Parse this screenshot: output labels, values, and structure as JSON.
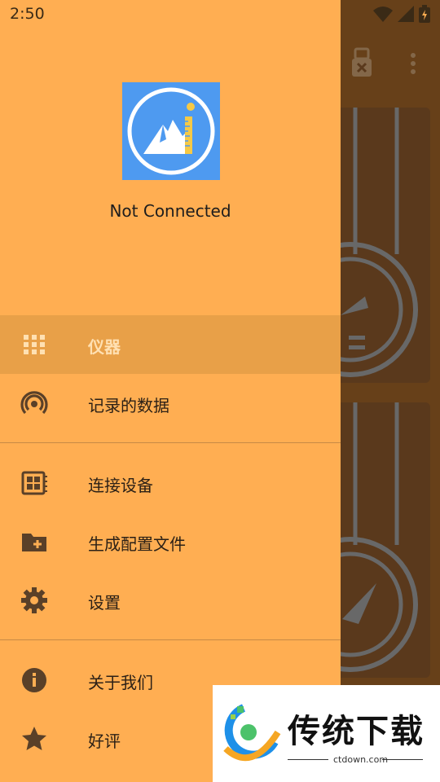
{
  "status_bar": {
    "time": "2:50"
  },
  "drawer": {
    "connection_status": "Not Connected",
    "menu": [
      {
        "label": "仪器",
        "icon": "grid-icon",
        "active": true
      },
      {
        "label": "记录的数据",
        "icon": "broadcast-icon"
      },
      {
        "label": "连接设备",
        "icon": "device-board-icon"
      },
      {
        "label": "生成配置文件",
        "icon": "folder-add-icon"
      },
      {
        "label": "设置",
        "icon": "gear-icon"
      },
      {
        "label": "关于我们",
        "icon": "info-icon"
      },
      {
        "label": "好评",
        "icon": "star-icon"
      }
    ]
  },
  "watermark": {
    "title": "传统下载",
    "url": "ctdown.com"
  },
  "colors": {
    "drawer_bg": "#ffae52",
    "active_row": "#e8a048",
    "logo_bg": "#4e9af0",
    "app_bg": "#7a4c1e"
  }
}
